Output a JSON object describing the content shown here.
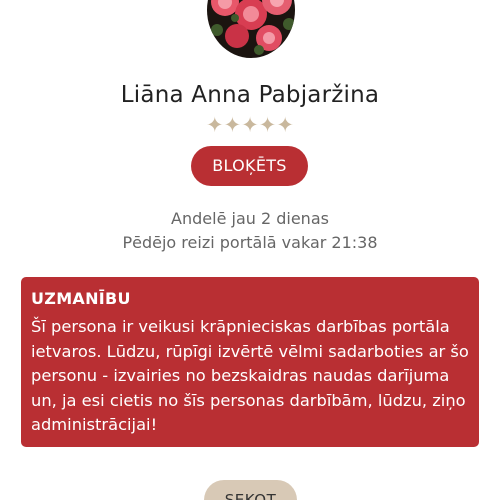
{
  "profile": {
    "name": "Liāna Anna Pabjaržina",
    "rating_stars": "✦✦✦✦✦",
    "status_badge": "BLOĶĒTS",
    "member_since": "Andelē jau 2 dienas",
    "last_seen": "Pēdējo reizi portālā vakar 21:38"
  },
  "warning": {
    "title": "UZMANĪBU",
    "text": "Šī persona ir veikusi krāpnieciskas darbības portāla ietvaros. Lūdzu, rūpīgi izvērtē vēlmi sadarboties ar šo personu - izvairies no bezskaidras naudas darījuma un, ja esi cietis no šīs personas darbībām, lūdzu, ziņo administrācijai!"
  },
  "actions": {
    "follow_label": "SEKOT"
  },
  "colors": {
    "accent_red": "#b92f33",
    "beige": "#d8c9b6",
    "star": "#c9b89d"
  }
}
